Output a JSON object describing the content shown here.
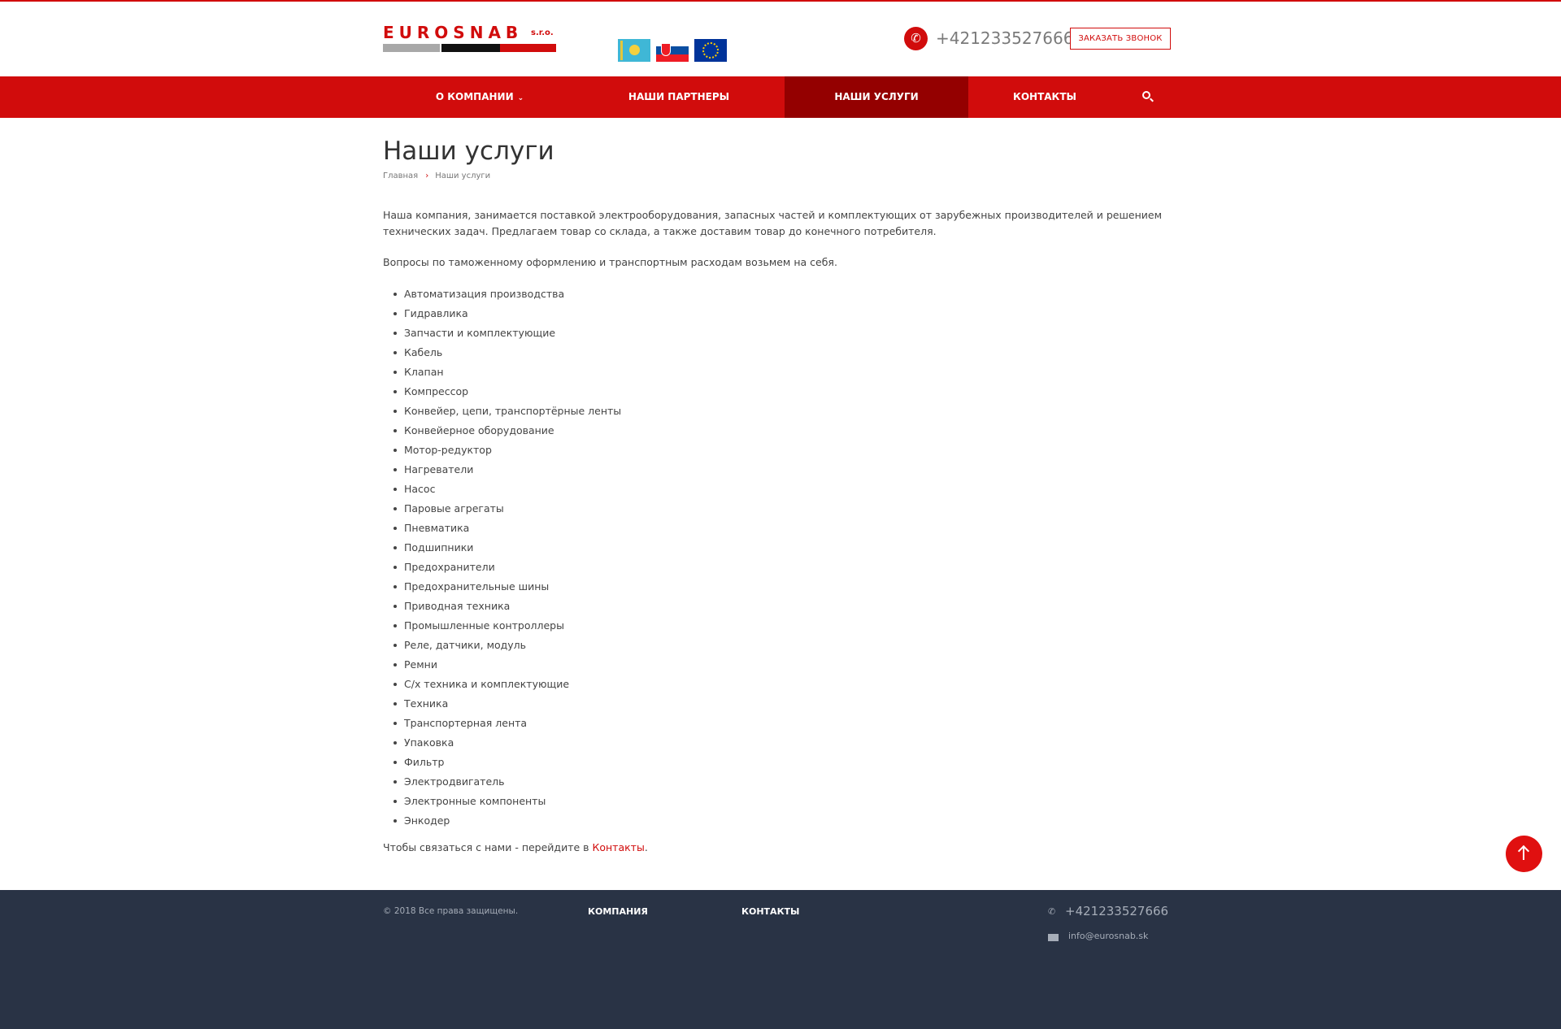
{
  "header": {
    "logo_text": "EUROSNAB",
    "logo_suffix": "s.r.o.",
    "phone": "+421233527666",
    "call_button": "ЗАКАЗАТЬ ЗВОНОК",
    "brand_color": "#d10c0c"
  },
  "nav": {
    "items": [
      {
        "label": "О КОМПАНИИ",
        "has_dropdown": true
      },
      {
        "label": "НАШИ ПАРТНЕРЫ"
      },
      {
        "label": "НАШИ УСЛУГИ",
        "active": true
      },
      {
        "label": "КОНТАКТЫ"
      }
    ],
    "search_icon": "search-icon",
    "active_color": "#940000"
  },
  "page": {
    "title": "Наши услуги",
    "breadcrumb": {
      "home": "Главная",
      "current": "Наши услуги"
    },
    "intro": "Наша компания, занимается поставкой электрооборудования, запасных частей и комплектующих от зарубежных производителей и решением технических задач. Предлагаем товар со склада, а также доставим товар до конечного потребителя.",
    "intro2": "Вопросы по таможенному оформлению и транспортным расходам возьмем на себя.",
    "services": [
      "Автоматизация производства",
      "Гидравлика",
      "Запчасти и комплектующие",
      "Кабель",
      "Клапан",
      "Компрессор",
      "Конвейер, цепи, транспортёрные ленты",
      "Конвейерное оборудование",
      "Мотор-редуктор",
      "Нагреватели",
      "Насос",
      "Паровые агрегаты",
      "Пневматика",
      "Подшипники",
      "Предохранители",
      "Предохранительные шины",
      "Приводная техника",
      "Промышленные контроллеры",
      "Реле, датчики, модуль",
      "Ремни",
      "С/х техника и комплектующие",
      "Техника",
      "Транспортерная лента",
      "Упаковка",
      "Фильтр",
      "Электродвигатель",
      "Электронные компоненты",
      "Энкодер"
    ],
    "contact_prefix": "Чтобы связаться с нами - перейдите в ",
    "contact_link": "Контакты",
    "contact_suffix": "."
  },
  "footer": {
    "copyright": "© 2018 Все права защищены.",
    "col1": "КОМПАНИЯ",
    "col2": "КОНТАКТЫ",
    "phone": "+421233527666",
    "email": "info@eurosnab.sk",
    "bg_color": "#293345"
  }
}
